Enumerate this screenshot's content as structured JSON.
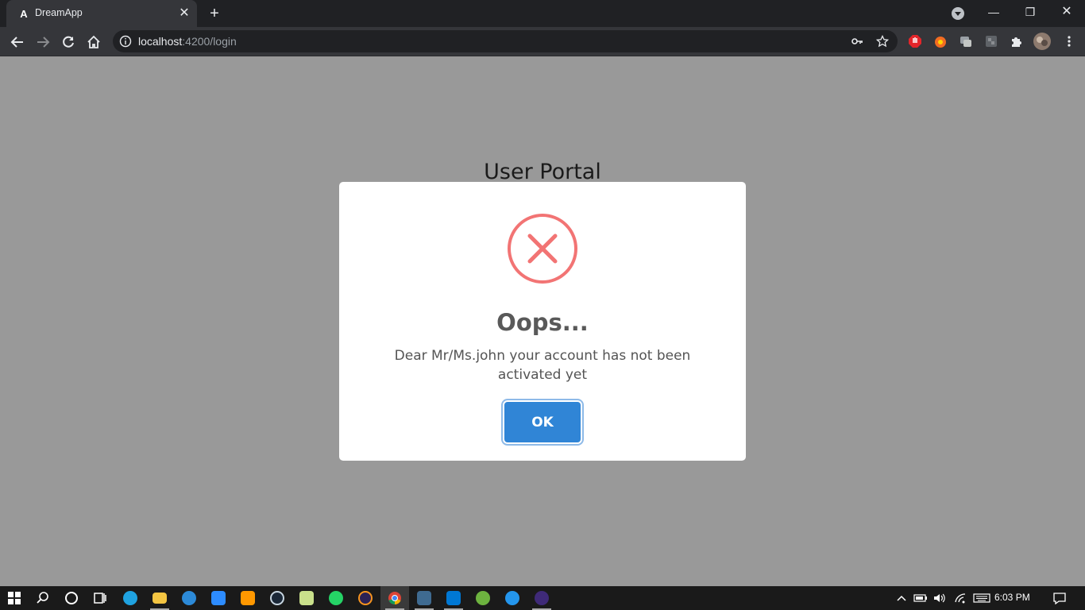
{
  "browser": {
    "tab_title": "DreamApp",
    "url_host": "localhost",
    "url_path": ":4200/login"
  },
  "page": {
    "portal_title": "User Portal"
  },
  "dialog": {
    "title": "Oops...",
    "message": "Dear Mr/Ms.john your account has not been activated yet",
    "ok_label": "OK",
    "icon": "error-x-icon"
  },
  "taskbar": {
    "clock": "6:03 PM"
  },
  "colors": {
    "overlay": "#999999",
    "error_icon": "#f27474",
    "ok_button": "#3085d6"
  }
}
